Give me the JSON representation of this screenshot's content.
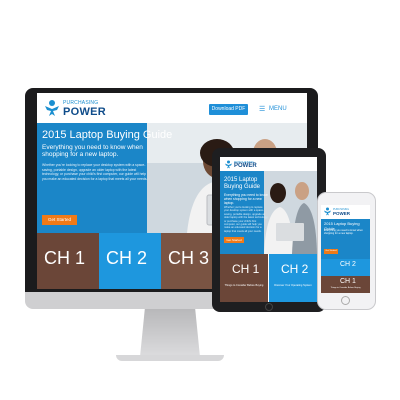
{
  "brand": {
    "name_small": "PURCHASING",
    "name_big": "POWER"
  },
  "header": {
    "download_label": "Download PDF",
    "menu_label": "MENU"
  },
  "hero": {
    "title": "2015 Laptop Buying Guide",
    "subtitle": "Everything you need to know when shopping for a new laptop.",
    "body": "Whether you're looking to replace your desktop system with a space-saving, portable design, upgrade an older laptop with the latest technology, or purchase your child's first computer, our guide will help you make an educated decision for a laptop that meets all your needs.",
    "cta_label": "Get Started"
  },
  "chapters": [
    {
      "label": "CH 1",
      "caption": "Things to Consider Before Buying"
    },
    {
      "label": "CH 2",
      "caption": "Discover Your Operating System"
    },
    {
      "label": "CH 3",
      "caption": ""
    }
  ],
  "colors": {
    "brand_blue": "#1b86c8",
    "cta_orange": "#f07a17",
    "brand_navy": "#0f4c8a"
  }
}
